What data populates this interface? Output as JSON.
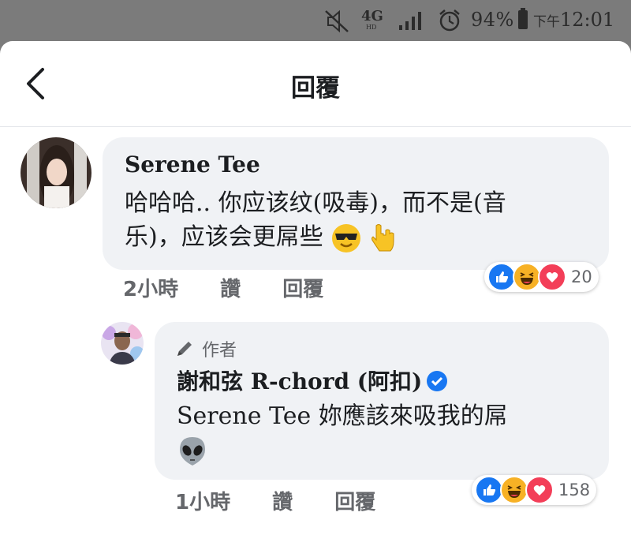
{
  "status_bar": {
    "network": "4G",
    "network_sub": "HD",
    "battery": "94%",
    "time_prefix": "下午",
    "time": "12:01"
  },
  "header": {
    "title": "回覆"
  },
  "comments": [
    {
      "author": "Serene Tee",
      "text_line1": "哈哈哈.. 你应该纹(吸毒)，而不是(音",
      "text_line2": "乐)，应该会更屌些",
      "time": "2小時",
      "like_label": "讚",
      "reply_label": "回覆",
      "reaction_count": "20"
    },
    {
      "badge": "作者",
      "author": "謝和弦 R-chord (阿扣)",
      "text_line1": "Serene Tee 妳應該來吸我的屌",
      "time": "1小時",
      "like_label": "讚",
      "reply_label": "回覆",
      "reaction_count": "158"
    }
  ],
  "colors": {
    "accent": "#1877f2",
    "bubble": "#f0f2f5",
    "status_bar": "#7b7b7b",
    "love": "#f33e58",
    "haha": "#f7b125"
  }
}
